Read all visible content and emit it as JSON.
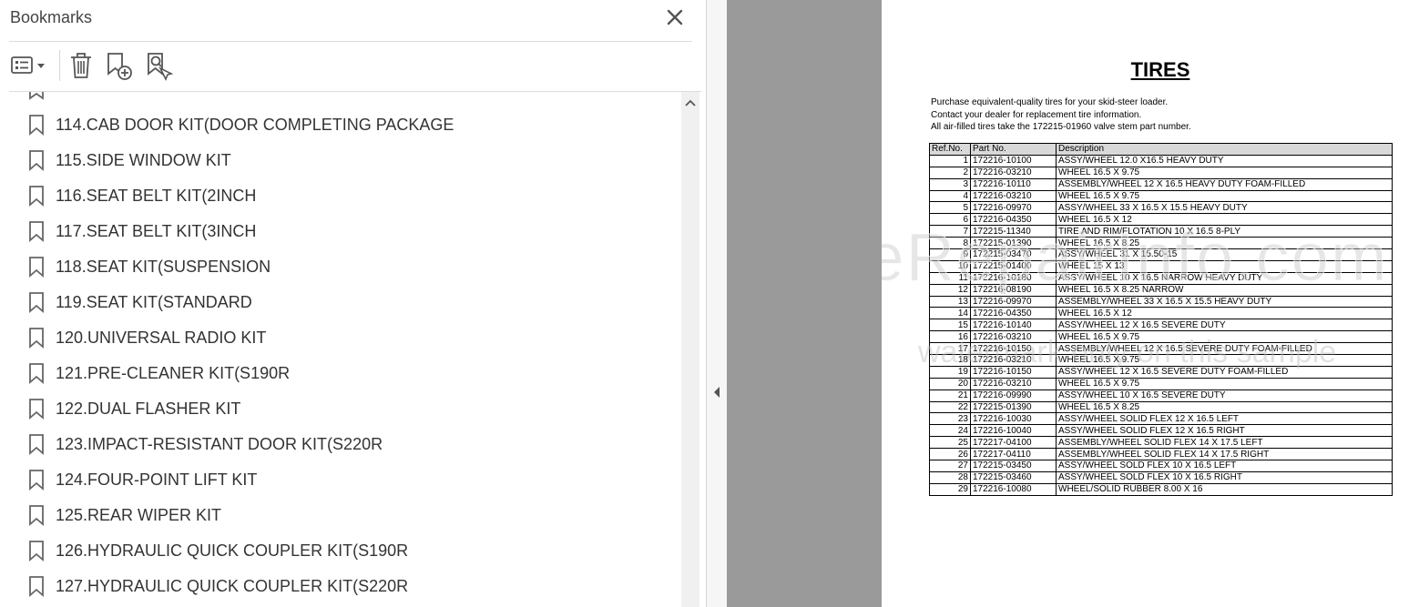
{
  "panel": {
    "title": "Bookmarks",
    "items": [
      {
        "label": "114.CAB DOOR KIT(DOOR COMPLETING PACKAGE"
      },
      {
        "label": "115.SIDE WINDOW KIT"
      },
      {
        "label": "116.SEAT BELT KIT(2INCH"
      },
      {
        "label": "117.SEAT BELT KIT(3INCH"
      },
      {
        "label": "118.SEAT KIT(SUSPENSION"
      },
      {
        "label": "119.SEAT KIT(STANDARD"
      },
      {
        "label": "120.UNIVERSAL RADIO KIT"
      },
      {
        "label": "121.PRE-CLEANER KIT(S190R"
      },
      {
        "label": "122.DUAL FLASHER KIT"
      },
      {
        "label": "123.IMPACT-RESISTANT DOOR KIT(S220R"
      },
      {
        "label": "124.FOUR-POINT LIFT KIT"
      },
      {
        "label": "125.REAR WIPER KIT"
      },
      {
        "label": "126.HYDRAULIC QUICK COUPLER KIT(S190R"
      },
      {
        "label": "127.HYDRAULIC QUICK COUPLER KIT(S220R"
      }
    ]
  },
  "document": {
    "title": "TIRES",
    "intro": [
      "Purchase equivalent-quality tires for your skid-steer loader.",
      "Contact your dealer for replacement tire information.",
      "All air-filled tires take the 172215-01960 valve stem part number."
    ],
    "table": {
      "headers": [
        "Ref.No.",
        "Part No.",
        "Description"
      ],
      "rows": [
        [
          "1",
          "172216-10100",
          "ASSY/WHEEL 12.0 X16.5 HEAVY DUTY"
        ],
        [
          "2",
          "172216-03210",
          "WHEEL 16.5 X 9.75"
        ],
        [
          "3",
          "172216-10110",
          "ASSEMBLY/WHEEL 12 X 16.5 HEAVY DUTY FOAM-FILLED"
        ],
        [
          "4",
          "172216-03210",
          "WHEEL 16.5 X 9.75"
        ],
        [
          "5",
          "172216-09970",
          "ASSY/WHEEL 33 X 16.5 X 15.5 HEAVY DUTY"
        ],
        [
          "6",
          "172216-04350",
          "WHEEL 16.5 X 12"
        ],
        [
          "7",
          "172215-11340",
          "TIRE AND RIM/FLOTATION 10 X 16.5 8-PLY"
        ],
        [
          "8",
          "172215-01390",
          "WHEEL 16.5 X 8.25"
        ],
        [
          "9",
          "172215-03470",
          "ASSY/WHEEL 31 X 15.50-15"
        ],
        [
          "10",
          "172215-01400",
          "WHEEL 15 X 13"
        ],
        [
          "11",
          "172216-10180",
          "ASSY/WHEEL 10 X 16.5 NARROW HEAVY DUTY"
        ],
        [
          "12",
          "172216-08190",
          "WHEEL 16.5 X 8.25 NARROW"
        ],
        [
          "13",
          "172216-09970",
          "ASSEMBLY/WHEEL 33 X 16.5 X 15.5 HEAVY DUTY"
        ],
        [
          "14",
          "172216-04350",
          "WHEEL 16.5 X 12"
        ],
        [
          "15",
          "172216-10140",
          "ASSY/WHEEL 12 X 16.5 SEVERE DUTY"
        ],
        [
          "16",
          "172216-03210",
          "WHEEL 16.5 X 9.75"
        ],
        [
          "17",
          "172216-10150",
          "ASSEMBLY/WHEEL 12 X 16.5 SEVERE DUTY FOAM-FILLED"
        ],
        [
          "18",
          "172216-03210",
          "WHEEL 16.5 X 9.75"
        ],
        [
          "19",
          "172216-10150",
          "ASSY/WHEEL 12 X 16.5 SEVERE DUTY FOAM-FILLED"
        ],
        [
          "20",
          "172216-03210",
          "WHEEL 16.5 X 9.75"
        ],
        [
          "21",
          "172216-09990",
          "ASSY/WHEEL 10 X 16.5 SEVERE DUTY"
        ],
        [
          "22",
          "172215-01390",
          "WHEEL 16.5 X 8.25"
        ],
        [
          "23",
          "172216-10030",
          "ASSY/WHEEL SOLID FLEX 12 X 16.5 LEFT"
        ],
        [
          "24",
          "172216-10040",
          "ASSY/WHEEL SOLID FLEX 12 X 16.5 RIGHT"
        ],
        [
          "25",
          "172217-04100",
          "ASSEMBLY/WHEEL SOLID FLEX 14 X 17.5 LEFT"
        ],
        [
          "26",
          "172217-04110",
          "ASSEMBLY/WHEEL SOLID FLEX  14 X 17.5 RIGHT"
        ],
        [
          "27",
          "172215-03450",
          "ASSY/WHEEL SOLD FLEX 10 X 16.5 LEFT"
        ],
        [
          "28",
          "172215-03460",
          "ASSY/WHEEL SOLD FLEX 10 X 16.5 RIGHT"
        ],
        [
          "29",
          "172216-10080",
          "WHEEL/SOLID RUBBER 8.00 X 16"
        ]
      ]
    },
    "watermark": {
      "line1": "eRepairInfo.com",
      "line2": "watermark only on this sample"
    }
  }
}
